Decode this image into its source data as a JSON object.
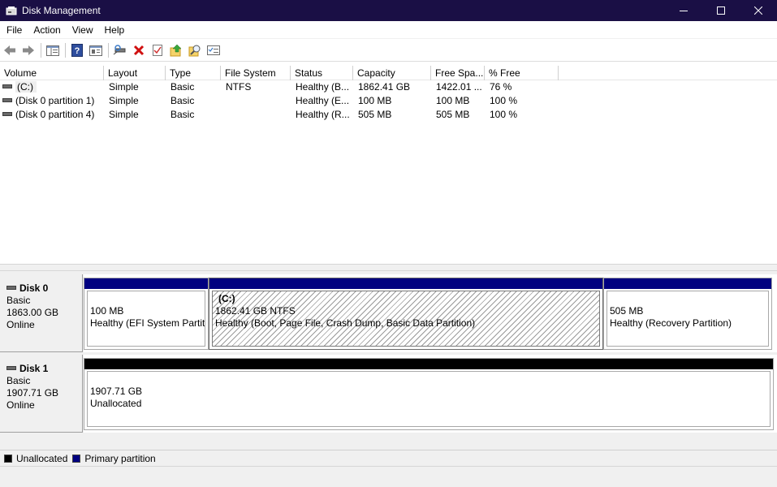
{
  "window": {
    "title": "Disk Management"
  },
  "menu": [
    "File",
    "Action",
    "View",
    "Help"
  ],
  "toolbar": {
    "buttons": [
      "back-icon",
      "forward-icon",
      "show-hide-console-tree-icon",
      "properties-icon",
      "help-icon",
      "connect-icon",
      "delete-icon",
      "check-icon",
      "up-folder-icon",
      "search-icon",
      "list-icon"
    ]
  },
  "volume_list": {
    "columns": [
      "Volume",
      "Layout",
      "Type",
      "File System",
      "Status",
      "Capacity",
      "Free Spa...",
      "% Free"
    ],
    "rows": [
      [
        "(C:)",
        "Simple",
        "Basic",
        "NTFS",
        "Healthy (B...",
        "1862.41 GB",
        "1422.01 ...",
        "76 %"
      ],
      [
        "(Disk 0 partition 1)",
        "Simple",
        "Basic",
        "",
        "Healthy (E...",
        "100 MB",
        "100 MB",
        "100 %"
      ],
      [
        "(Disk 0 partition 4)",
        "Simple",
        "Basic",
        "",
        "Healthy (R...",
        "505 MB",
        "505 MB",
        "100 %"
      ]
    ]
  },
  "disks": [
    {
      "name": "Disk 0",
      "type": "Basic",
      "size": "1863.00 GB",
      "state": "Online",
      "partitions": [
        {
          "name": "",
          "size": "100 MB",
          "status": "Healthy (EFI System Partiti"
        },
        {
          "name": "(C:)",
          "size": "1862.41 GB NTFS",
          "status": "Healthy (Boot, Page File, Crash Dump, Basic Data Partition)"
        },
        {
          "name": "",
          "size": "505 MB",
          "status": "Healthy (Recovery Partition)"
        }
      ]
    },
    {
      "name": "Disk 1",
      "type": "Basic",
      "size": "1907.71 GB",
      "state": "Online",
      "partitions": [
        {
          "name": "",
          "size": "1907.71 GB",
          "status": "Unallocated"
        }
      ]
    }
  ],
  "legend": [
    {
      "label": "Unallocated",
      "color": "#000000"
    },
    {
      "label": "Primary partition",
      "color": "#000080"
    }
  ],
  "colors": {
    "titlebar": "#1a0f45",
    "primary_partition": "#000080",
    "unallocated": "#000000"
  }
}
